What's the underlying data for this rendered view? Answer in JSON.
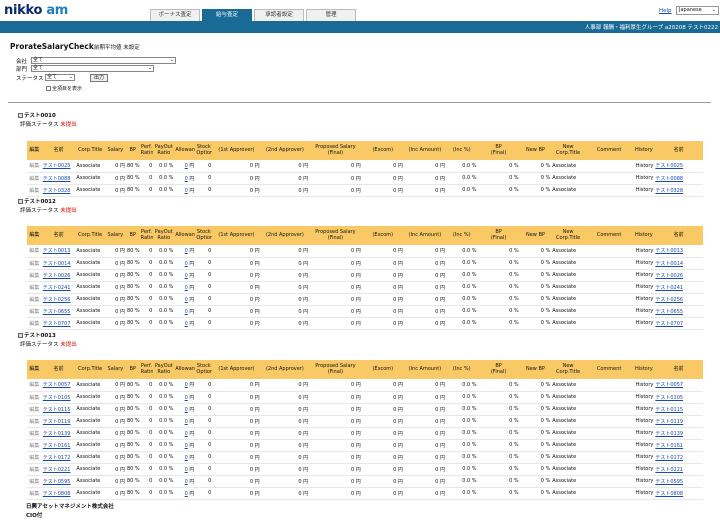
{
  "header": {
    "logo_main": "nikko",
    "logo_accent": "am",
    "tabs": [
      "ボーナス査定",
      "給与査定",
      "承認者設定",
      "管理"
    ],
    "active_tab": 1,
    "help": "Help",
    "language": "Japanese",
    "user": "人事部 報酬・福利厚生グループ a20208 テスト0222"
  },
  "page": {
    "title": "ProrateSalaryCheck",
    "subtitle": "前期平均値 未設定",
    "filters": {
      "company_label": "会社",
      "company_value": "全て",
      "dept_label": "部門",
      "dept_value": "全て",
      "status_label": "ステータス",
      "status_value": "全て",
      "output_button": "出力",
      "show_all_label": "全項目を表示"
    }
  },
  "table_headers": {
    "edit": "編集",
    "name": "名前",
    "corp_title": "Corp.Title",
    "salary": "Salary",
    "bp": "BP",
    "perf": "Perf.\nRating",
    "payout": "PayOut\nRatio",
    "allowance": "Allowance",
    "stock": "Stock\nOption",
    "first": "(1st Approver)",
    "second": "(2nd Approver)",
    "proposed": "Proposed Salary\n(Final)",
    "excom": "(Excom)",
    "inc_amt": "(Inc Amount)",
    "inc_pct": "(Inc %)",
    "bp_final": "BP\n(Final)",
    "new_bp": "New BP",
    "new_corp": "New\nCorp.Title",
    "comment": "Comment",
    "history": "History",
    "name2": "名前"
  },
  "row_values": {
    "edit": "編集",
    "title": "Associate",
    "salary": "0 円",
    "bp": "80 %",
    "perf": "0",
    "payout": "0.0 %",
    "allowance": "0",
    "yen": "円",
    "stock": "0",
    "amt": "0 円",
    "pct": "0.0 %",
    "bp_final": "0 %",
    "new_bp": "0 %",
    "history": "History"
  },
  "sections": [
    {
      "group": "テスト0010",
      "status_label": "評価ステータス",
      "status_value": "未提出",
      "rows": [
        "テスト0025",
        "テスト0088",
        "テスト0328"
      ]
    },
    {
      "group": "テスト0012",
      "status_label": "評価ステータス",
      "status_value": "未提出",
      "rows": [
        "テスト0013",
        "テスト0014",
        "テスト0026",
        "テスト0241",
        "テスト0256",
        "テスト0655",
        "テスト0707"
      ]
    },
    {
      "group": "テスト0013",
      "status_label": "評価ステータス",
      "status_value": "未提出",
      "rows": [
        "テスト0057",
        "テスト0105",
        "テスト0115",
        "テスト0119",
        "テスト0139",
        "テスト0161",
        "テスト0172",
        "テスト0221",
        "テスト0595",
        "テスト0808"
      ]
    }
  ],
  "footer": {
    "company": "日興アセットマネジメント株式会社",
    "cio": "CIO付"
  },
  "colors": {
    "brand_blue": "#1a6a96",
    "header_row": "#f9c966",
    "status_red": "#dd0000",
    "link": "#1a4bb4"
  }
}
